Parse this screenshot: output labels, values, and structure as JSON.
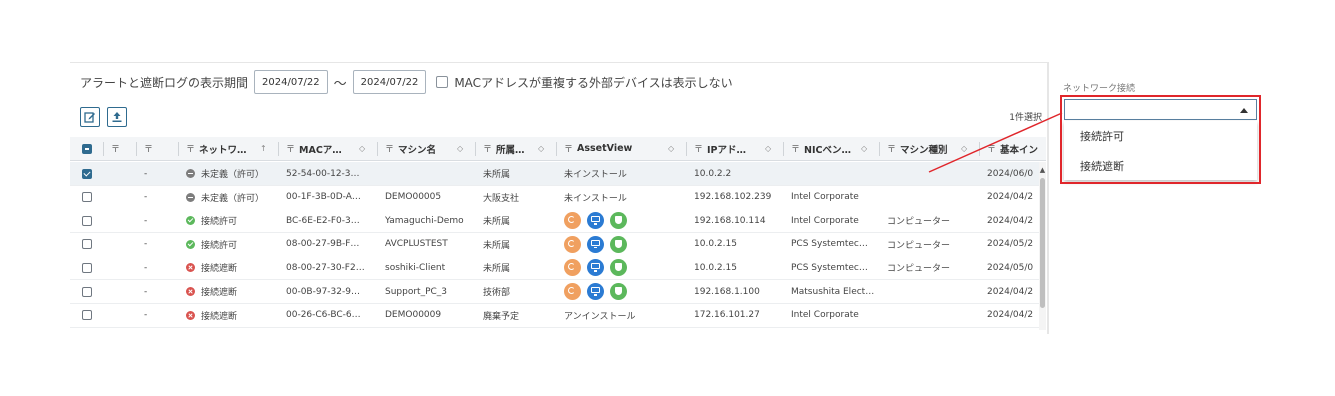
{
  "filter": {
    "label": "アラートと遮断ログの表示期間",
    "date_from": "2024/07/22",
    "tilde": "〜",
    "date_to": "2024/07/22",
    "mac_dup_label": "MACアドレスが重複する外部デバイスは表示しない"
  },
  "toolbar": {
    "edit_icon": "edit-icon",
    "export_icon": "upload-icon",
    "selected_count": "1件選択"
  },
  "grid": {
    "columns": [
      {
        "label": "",
        "filter_icon": "",
        "sort": ""
      },
      {
        "label": "",
        "filter_icon": "〒",
        "sort": ""
      },
      {
        "label": "",
        "filter_icon": "〒",
        "sort": ""
      },
      {
        "label": "ネットワ…",
        "filter_icon": "〒",
        "sort": "↑"
      },
      {
        "label": "MACア…",
        "filter_icon": "〒",
        "sort": "◇"
      },
      {
        "label": "マシン名",
        "filter_icon": "〒",
        "sort": "◇"
      },
      {
        "label": "所属…",
        "filter_icon": "〒",
        "sort": "◇"
      },
      {
        "label": "AssetView",
        "filter_icon": "〒",
        "sort": "◇"
      },
      {
        "label": "IPアド…",
        "filter_icon": "〒",
        "sort": "◇"
      },
      {
        "label": "NICベン…",
        "filter_icon": "〒",
        "sort": "◇"
      },
      {
        "label": "マシン種別",
        "filter_icon": "〒",
        "sort": "◇"
      },
      {
        "label": "基本イン",
        "filter_icon": "〒",
        "sort": ""
      }
    ],
    "rows": [
      {
        "checked": true,
        "dash": "-",
        "status": "undef",
        "network": "未定義（許可）",
        "mac": "52-54-00-12-3…",
        "machine": "",
        "dept": "未所属",
        "asset_text": "未インストール",
        "asset_icons": false,
        "ip": "10.0.2.2",
        "nic": "",
        "mtype": "",
        "basic": "2024/06/0"
      },
      {
        "checked": false,
        "dash": "-",
        "status": "undef",
        "network": "未定義（許可）",
        "mac": "00-1F-3B-0D-A…",
        "machine": "DEMO00005",
        "dept": "大阪支社",
        "asset_text": "未インストール",
        "asset_icons": false,
        "ip": "192.168.102.239",
        "nic": "Intel Corporate",
        "mtype": "",
        "basic": "2024/04/2"
      },
      {
        "checked": false,
        "dash": "-",
        "status": "allow",
        "network": "接続許可",
        "mac": "BC-6E-E2-F0-3…",
        "machine": "Yamaguchi-Demo",
        "dept": "未所属",
        "asset_text": "",
        "asset_icons": true,
        "ip": "192.168.10.114",
        "nic": "Intel Corporate",
        "mtype": "コンピューター",
        "basic": "2024/04/2"
      },
      {
        "checked": false,
        "dash": "-",
        "status": "allow",
        "network": "接続許可",
        "mac": "08-00-27-9B-F…",
        "machine": "AVCPLUSTEST",
        "dept": "未所属",
        "asset_text": "",
        "asset_icons": true,
        "ip": "10.0.2.15",
        "nic": "PCS Systemtec…",
        "mtype": "コンピューター",
        "basic": "2024/05/2"
      },
      {
        "checked": false,
        "dash": "-",
        "status": "block",
        "network": "接続遮断",
        "mac": "08-00-27-30-F2…",
        "machine": "soshiki-Client",
        "dept": "未所属",
        "asset_text": "",
        "asset_icons": true,
        "ip": "10.0.2.15",
        "nic": "PCS Systemtec…",
        "mtype": "コンピューター",
        "basic": "2024/05/0"
      },
      {
        "checked": false,
        "dash": "-",
        "status": "block",
        "network": "接続遮断",
        "mac": "00-0B-97-32-9…",
        "machine": "Support_PC_3",
        "dept": "技術部",
        "asset_text": "",
        "asset_icons": true,
        "ip": "192.168.1.100",
        "nic": "Matsushita Elect…",
        "mtype": "",
        "basic": "2024/04/2"
      },
      {
        "checked": false,
        "dash": "-",
        "status": "block",
        "network": "接続遮断",
        "mac": "00-26-C6-BC-6…",
        "machine": "DEMO00009",
        "dept": "廃棄予定",
        "asset_text": "アンインストール",
        "asset_icons": false,
        "ip": "172.16.101.27",
        "nic": "Intel Corporate",
        "mtype": "",
        "basic": "2024/04/2"
      }
    ]
  },
  "side_filter": {
    "label": "ネットワーク接続",
    "value": "",
    "options": [
      "接続許可",
      "接続遮断"
    ]
  },
  "colors": {
    "accent": "#2f6b8f",
    "highlight": "#e0262b",
    "allow": "#5cb85c",
    "block": "#d9534f",
    "undefined": "#7d7d7d"
  }
}
